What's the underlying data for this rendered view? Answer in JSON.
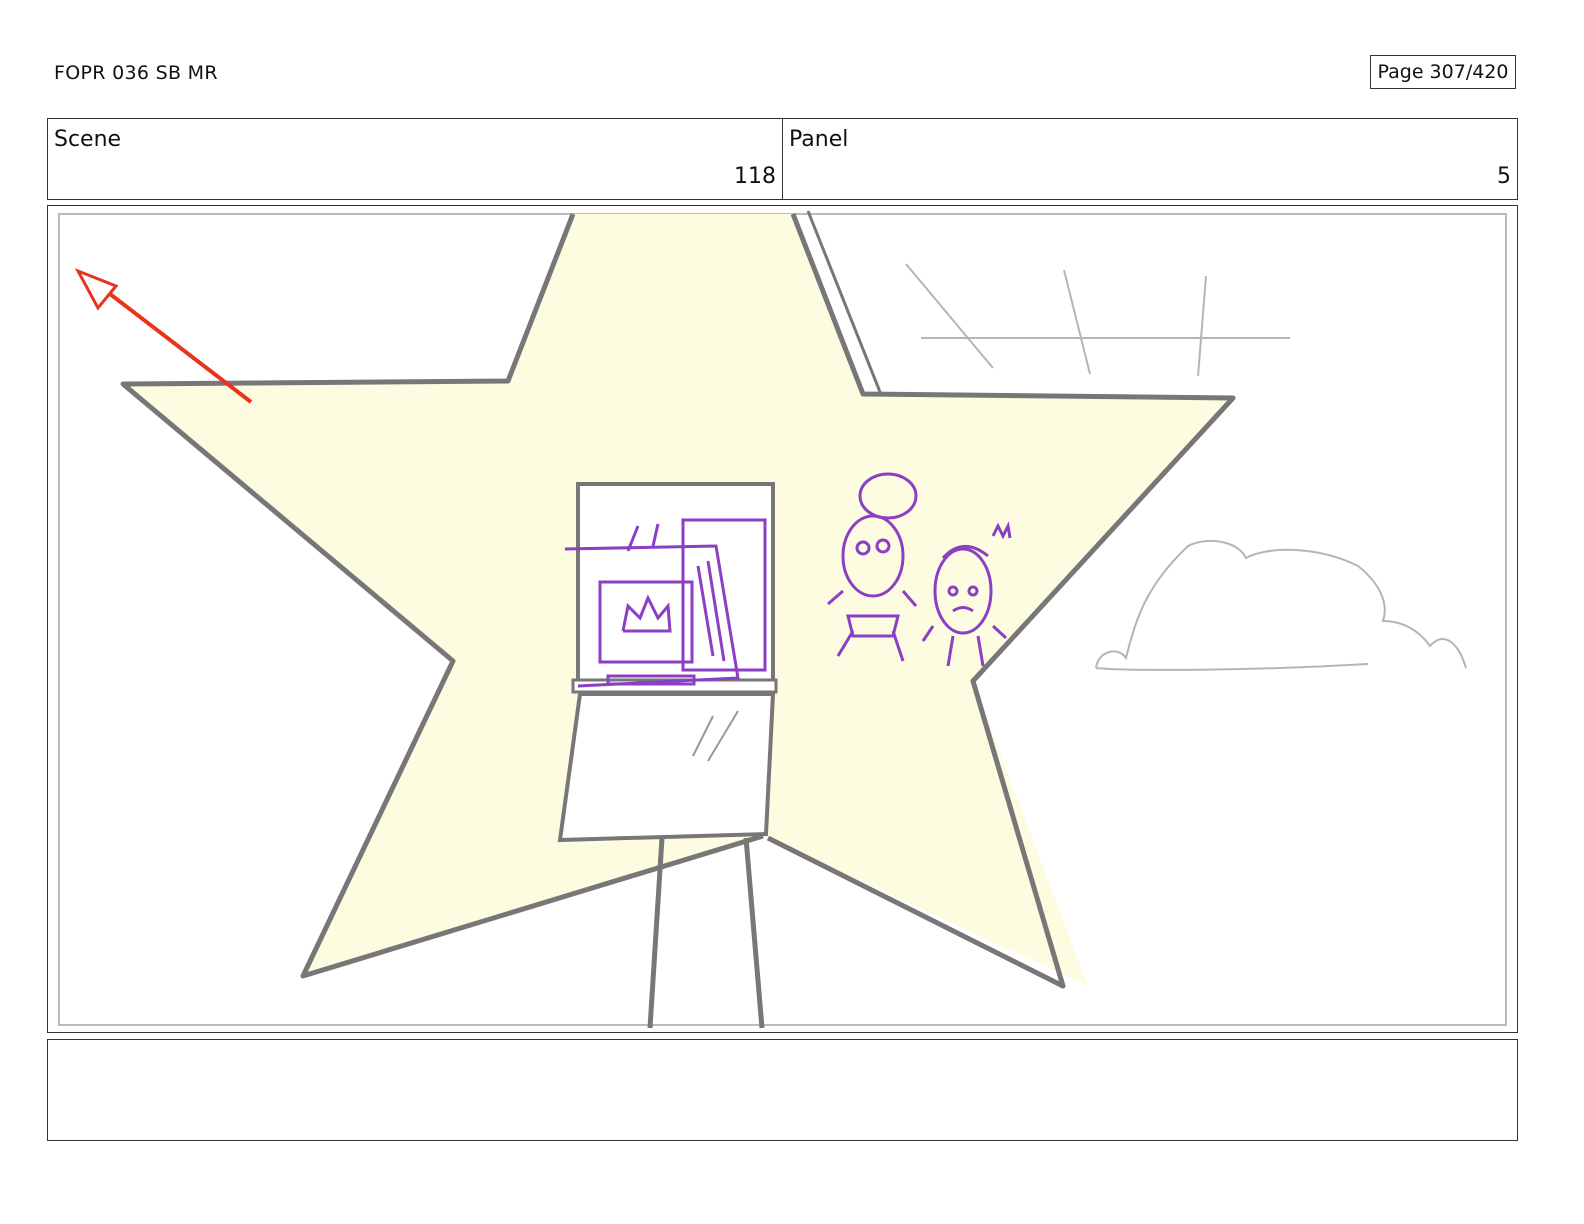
{
  "header": {
    "document_title": "FOPR 036 SB MR",
    "page_label": "Page 307/420"
  },
  "info": {
    "scene_label": "Scene",
    "scene_value": "118",
    "panel_label": "Panel",
    "panel_value": "5"
  },
  "drawing": {
    "star_fill": "#fdfbe0",
    "outline": "#777777",
    "characters": "#8a3fc4",
    "arrow": "#e8341c",
    "sky_sketch": "#b5b5b5"
  },
  "notes": {
    "text": ""
  }
}
